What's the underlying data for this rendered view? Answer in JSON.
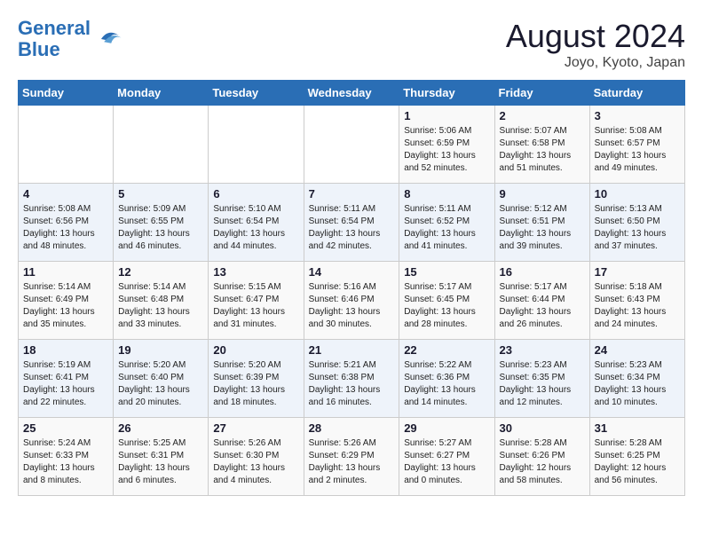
{
  "header": {
    "logo_line1": "General",
    "logo_line2": "Blue",
    "month_year": "August 2024",
    "location": "Joyo, Kyoto, Japan"
  },
  "weekdays": [
    "Sunday",
    "Monday",
    "Tuesday",
    "Wednesday",
    "Thursday",
    "Friday",
    "Saturday"
  ],
  "weeks": [
    [
      {
        "day": "",
        "info": ""
      },
      {
        "day": "",
        "info": ""
      },
      {
        "day": "",
        "info": ""
      },
      {
        "day": "",
        "info": ""
      },
      {
        "day": "1",
        "info": "Sunrise: 5:06 AM\nSunset: 6:59 PM\nDaylight: 13 hours\nand 52 minutes."
      },
      {
        "day": "2",
        "info": "Sunrise: 5:07 AM\nSunset: 6:58 PM\nDaylight: 13 hours\nand 51 minutes."
      },
      {
        "day": "3",
        "info": "Sunrise: 5:08 AM\nSunset: 6:57 PM\nDaylight: 13 hours\nand 49 minutes."
      }
    ],
    [
      {
        "day": "4",
        "info": "Sunrise: 5:08 AM\nSunset: 6:56 PM\nDaylight: 13 hours\nand 48 minutes."
      },
      {
        "day": "5",
        "info": "Sunrise: 5:09 AM\nSunset: 6:55 PM\nDaylight: 13 hours\nand 46 minutes."
      },
      {
        "day": "6",
        "info": "Sunrise: 5:10 AM\nSunset: 6:54 PM\nDaylight: 13 hours\nand 44 minutes."
      },
      {
        "day": "7",
        "info": "Sunrise: 5:11 AM\nSunset: 6:54 PM\nDaylight: 13 hours\nand 42 minutes."
      },
      {
        "day": "8",
        "info": "Sunrise: 5:11 AM\nSunset: 6:52 PM\nDaylight: 13 hours\nand 41 minutes."
      },
      {
        "day": "9",
        "info": "Sunrise: 5:12 AM\nSunset: 6:51 PM\nDaylight: 13 hours\nand 39 minutes."
      },
      {
        "day": "10",
        "info": "Sunrise: 5:13 AM\nSunset: 6:50 PM\nDaylight: 13 hours\nand 37 minutes."
      }
    ],
    [
      {
        "day": "11",
        "info": "Sunrise: 5:14 AM\nSunset: 6:49 PM\nDaylight: 13 hours\nand 35 minutes."
      },
      {
        "day": "12",
        "info": "Sunrise: 5:14 AM\nSunset: 6:48 PM\nDaylight: 13 hours\nand 33 minutes."
      },
      {
        "day": "13",
        "info": "Sunrise: 5:15 AM\nSunset: 6:47 PM\nDaylight: 13 hours\nand 31 minutes."
      },
      {
        "day": "14",
        "info": "Sunrise: 5:16 AM\nSunset: 6:46 PM\nDaylight: 13 hours\nand 30 minutes."
      },
      {
        "day": "15",
        "info": "Sunrise: 5:17 AM\nSunset: 6:45 PM\nDaylight: 13 hours\nand 28 minutes."
      },
      {
        "day": "16",
        "info": "Sunrise: 5:17 AM\nSunset: 6:44 PM\nDaylight: 13 hours\nand 26 minutes."
      },
      {
        "day": "17",
        "info": "Sunrise: 5:18 AM\nSunset: 6:43 PM\nDaylight: 13 hours\nand 24 minutes."
      }
    ],
    [
      {
        "day": "18",
        "info": "Sunrise: 5:19 AM\nSunset: 6:41 PM\nDaylight: 13 hours\nand 22 minutes."
      },
      {
        "day": "19",
        "info": "Sunrise: 5:20 AM\nSunset: 6:40 PM\nDaylight: 13 hours\nand 20 minutes."
      },
      {
        "day": "20",
        "info": "Sunrise: 5:20 AM\nSunset: 6:39 PM\nDaylight: 13 hours\nand 18 minutes."
      },
      {
        "day": "21",
        "info": "Sunrise: 5:21 AM\nSunset: 6:38 PM\nDaylight: 13 hours\nand 16 minutes."
      },
      {
        "day": "22",
        "info": "Sunrise: 5:22 AM\nSunset: 6:36 PM\nDaylight: 13 hours\nand 14 minutes."
      },
      {
        "day": "23",
        "info": "Sunrise: 5:23 AM\nSunset: 6:35 PM\nDaylight: 13 hours\nand 12 minutes."
      },
      {
        "day": "24",
        "info": "Sunrise: 5:23 AM\nSunset: 6:34 PM\nDaylight: 13 hours\nand 10 minutes."
      }
    ],
    [
      {
        "day": "25",
        "info": "Sunrise: 5:24 AM\nSunset: 6:33 PM\nDaylight: 13 hours\nand 8 minutes."
      },
      {
        "day": "26",
        "info": "Sunrise: 5:25 AM\nSunset: 6:31 PM\nDaylight: 13 hours\nand 6 minutes."
      },
      {
        "day": "27",
        "info": "Sunrise: 5:26 AM\nSunset: 6:30 PM\nDaylight: 13 hours\nand 4 minutes."
      },
      {
        "day": "28",
        "info": "Sunrise: 5:26 AM\nSunset: 6:29 PM\nDaylight: 13 hours\nand 2 minutes."
      },
      {
        "day": "29",
        "info": "Sunrise: 5:27 AM\nSunset: 6:27 PM\nDaylight: 13 hours\nand 0 minutes."
      },
      {
        "day": "30",
        "info": "Sunrise: 5:28 AM\nSunset: 6:26 PM\nDaylight: 12 hours\nand 58 minutes."
      },
      {
        "day": "31",
        "info": "Sunrise: 5:28 AM\nSunset: 6:25 PM\nDaylight: 12 hours\nand 56 minutes."
      }
    ]
  ]
}
